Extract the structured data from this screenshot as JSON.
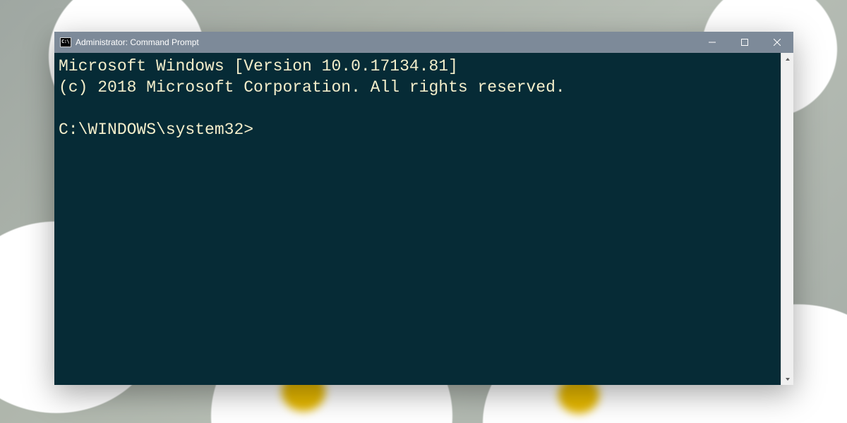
{
  "window": {
    "title": "Administrator: Command Prompt",
    "colors": {
      "titlebar": "#7d8a99",
      "terminal_bg": "#062b36",
      "terminal_fg": "#f3eecb"
    }
  },
  "terminal": {
    "line1": "Microsoft Windows [Version 10.0.17134.81]",
    "line2": "(c) 2018 Microsoft Corporation. All rights reserved.",
    "blank": "",
    "prompt": "C:\\WINDOWS\\system32>"
  }
}
